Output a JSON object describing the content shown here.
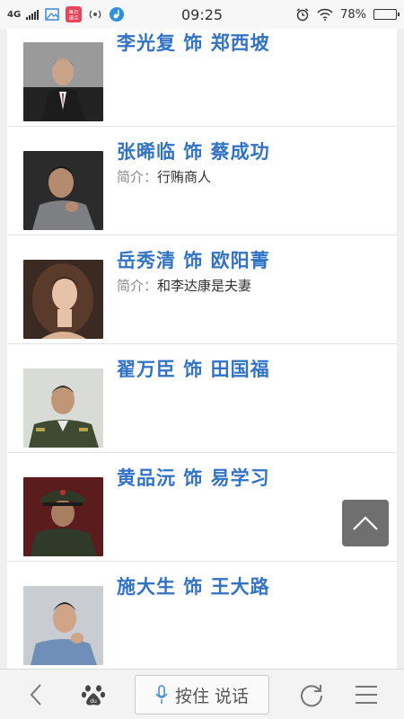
{
  "status_bar": {
    "network": "4G",
    "time": "09:25",
    "battery": "78%",
    "battery_level": 0.78,
    "app_badge_text": "每日\n速点"
  },
  "cast": [
    {
      "name": "李光复 饰 郑西坡",
      "desc_label": "",
      "desc_text": ""
    },
    {
      "name": "张晞临 饰 蔡成功",
      "desc_label": "简介：",
      "desc_text": "行贿商人"
    },
    {
      "name": "岳秀清 饰 欧阳菁",
      "desc_label": "简介：",
      "desc_text": "和李达康是夫妻"
    },
    {
      "name": "翟万臣 饰 田国福",
      "desc_label": "",
      "desc_text": ""
    },
    {
      "name": "黄品沅 饰 易学习",
      "desc_label": "",
      "desc_text": ""
    },
    {
      "name": "施大生 饰 王大路",
      "desc_label": "",
      "desc_text": ""
    }
  ],
  "bottom_bar": {
    "voice_label": "按住 说话",
    "icons": [
      "back-icon",
      "baidu-paw-icon",
      "microphone-icon",
      "refresh-icon",
      "menu-icon"
    ]
  },
  "colors": {
    "name_link": "#3273c6",
    "back_to_top_bg": "#6f6f6f"
  }
}
